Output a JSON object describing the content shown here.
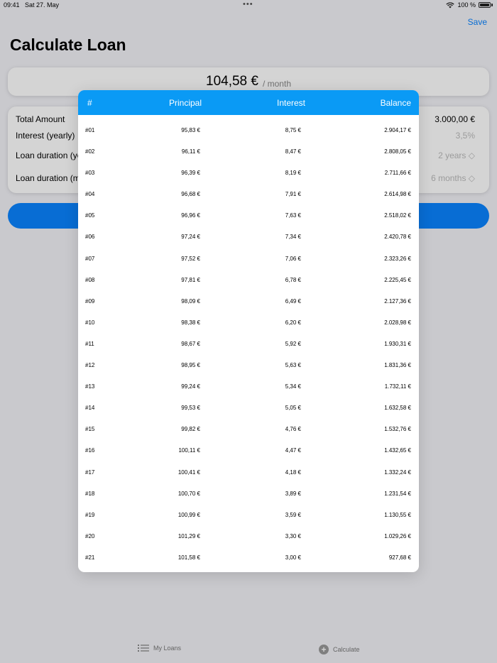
{
  "status": {
    "time": "09:41",
    "date": "Sat 27. May",
    "battery": "100 %"
  },
  "nav": {
    "save_label": "Save",
    "title": "Calculate Loan"
  },
  "monthly": {
    "amount": "104,58 €",
    "unit": "/ month"
  },
  "form": {
    "total_label": "Total Amount",
    "total_value": "3.000,00 €",
    "interest_label": "Interest (yearly)",
    "interest_value": "3,5%",
    "duration_years_label": "Loan duration (years)",
    "duration_years_value": "2 years ◇",
    "duration_months_label": "Loan duration (months)",
    "duration_months_value": "6 months ◇"
  },
  "tabs": {
    "my_loans": "My Loans",
    "calculate": "Calculate"
  },
  "table": {
    "headers": {
      "num": "#",
      "principal": "Principal",
      "interest": "Interest",
      "balance": "Balance"
    },
    "rows": [
      {
        "num": "#01",
        "principal": "95,83 €",
        "interest": "8,75 €",
        "balance": "2.904,17 €"
      },
      {
        "num": "#02",
        "principal": "96,11 €",
        "interest": "8,47 €",
        "balance": "2.808,05 €"
      },
      {
        "num": "#03",
        "principal": "96,39 €",
        "interest": "8,19 €",
        "balance": "2.711,66 €"
      },
      {
        "num": "#04",
        "principal": "96,68 €",
        "interest": "7,91 €",
        "balance": "2.614,98 €"
      },
      {
        "num": "#05",
        "principal": "96,96 €",
        "interest": "7,63 €",
        "balance": "2.518,02 €"
      },
      {
        "num": "#06",
        "principal": "97,24 €",
        "interest": "7,34 €",
        "balance": "2.420,78 €"
      },
      {
        "num": "#07",
        "principal": "97,52 €",
        "interest": "7,06 €",
        "balance": "2.323,26 €"
      },
      {
        "num": "#08",
        "principal": "97,81 €",
        "interest": "6,78 €",
        "balance": "2.225,45 €"
      },
      {
        "num": "#09",
        "principal": "98,09 €",
        "interest": "6,49 €",
        "balance": "2.127,36 €"
      },
      {
        "num": "#10",
        "principal": "98,38 €",
        "interest": "6,20 €",
        "balance": "2.028,98 €"
      },
      {
        "num": "#11",
        "principal": "98,67 €",
        "interest": "5,92 €",
        "balance": "1.930,31 €"
      },
      {
        "num": "#12",
        "principal": "98,95 €",
        "interest": "5,63 €",
        "balance": "1.831,36 €"
      },
      {
        "num": "#13",
        "principal": "99,24 €",
        "interest": "5,34 €",
        "balance": "1.732,11 €"
      },
      {
        "num": "#14",
        "principal": "99,53 €",
        "interest": "5,05 €",
        "balance": "1.632,58 €"
      },
      {
        "num": "#15",
        "principal": "99,82 €",
        "interest": "4,76 €",
        "balance": "1.532,76 €"
      },
      {
        "num": "#16",
        "principal": "100,11 €",
        "interest": "4,47 €",
        "balance": "1.432,65 €"
      },
      {
        "num": "#17",
        "principal": "100,41 €",
        "interest": "4,18 €",
        "balance": "1.332,24 €"
      },
      {
        "num": "#18",
        "principal": "100,70 €",
        "interest": "3,89 €",
        "balance": "1.231,54 €"
      },
      {
        "num": "#19",
        "principal": "100,99 €",
        "interest": "3,59 €",
        "balance": "1.130,55 €"
      },
      {
        "num": "#20",
        "principal": "101,29 €",
        "interest": "3,30 €",
        "balance": "1.029,26 €"
      },
      {
        "num": "#21",
        "principal": "101,58 €",
        "interest": "3,00 €",
        "balance": "927,68 €"
      }
    ]
  },
  "colors": {
    "accent": "#0a84ff",
    "header": "#0a9af5"
  }
}
